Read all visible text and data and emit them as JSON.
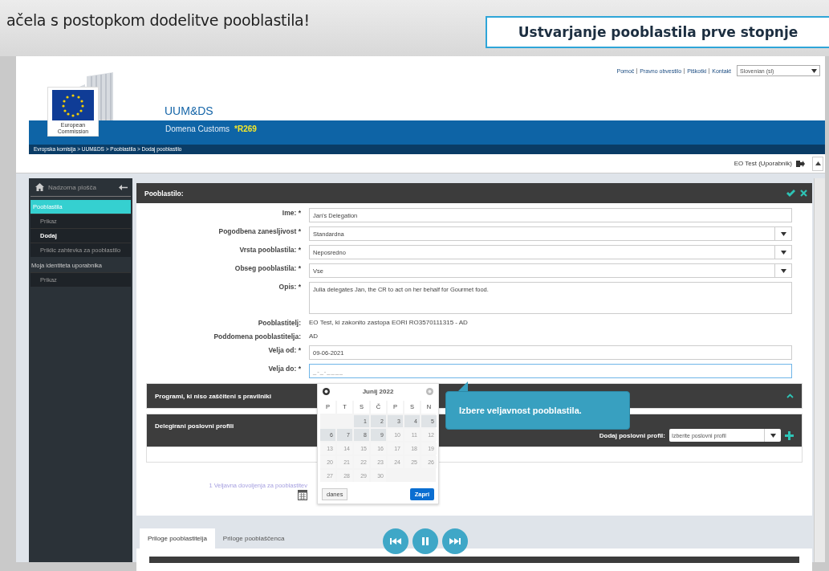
{
  "banner": {
    "caption": "ačela s postopkom dodelitve pooblastila!",
    "title": "Ustvarjanje pooblastila prve stopnje"
  },
  "top_links": [
    "Pomoč",
    "Pravno obvestilo",
    "Piškotki",
    "Kontakt"
  ],
  "language_select": {
    "value": "Slovenian (sl)"
  },
  "logo": {
    "caption": "European Commission"
  },
  "site": {
    "title": "UUM&DS",
    "domain": "Domena Customs",
    "code": "*R269"
  },
  "breadcrumb": "Evropska komisija > UUM&DS > Pooblastila > Dodaj pooblastilo",
  "user": {
    "name": "EO Test (Uporabnik)"
  },
  "sidebar": {
    "header": "Nadzorna plošča",
    "items": [
      {
        "label": "Pooblastila",
        "selected": true,
        "children": [
          {
            "label": "Prikaz",
            "selected": false
          },
          {
            "label": "Dodaj",
            "selected": true
          },
          {
            "label": "Priklic zahtevka za pooblastilo",
            "selected": false
          }
        ]
      },
      {
        "label": "Moja identiteta uporabnika",
        "selected": false,
        "children": [
          {
            "label": "Prikaz",
            "selected": false
          }
        ]
      }
    ]
  },
  "panel": {
    "title": "Pooblastilo:"
  },
  "fields": [
    {
      "kind": "text",
      "label": "Ime: *",
      "value": "Jan's Delegation"
    },
    {
      "kind": "select",
      "label": "Pogodbena zanesljivost *",
      "value": "Standardna"
    },
    {
      "kind": "select",
      "label": "Vrsta pooblastila: *",
      "value": "Neposredno"
    },
    {
      "kind": "select",
      "label": "Obseg pooblastila: *",
      "value": "Vse"
    },
    {
      "kind": "textarea",
      "label": "Opis: *",
      "value": "Julia delegates Jan, the CR to act on her behalf for Gourmet food."
    },
    {
      "kind": "static",
      "label": "Pooblastitelj:",
      "value": "EO Test, ki zakonito zastopa EORI RO3570111315 - AD"
    },
    {
      "kind": "static",
      "label": "Poddomena pooblastitelja:",
      "value": "AD"
    },
    {
      "kind": "text",
      "label": "Velja od: *",
      "value": "09-06-2021"
    },
    {
      "kind": "date",
      "label": "Velja do: *",
      "placeholder": "_-_-____"
    }
  ],
  "sections": [
    {
      "kind": "collapsible",
      "title": "Programi, ki niso zaščiteni s pravilniki"
    },
    {
      "kind": "profiles",
      "title": "Delegirani poslovni profili",
      "add_label": "Dodaj poslovni profil:",
      "select_placeholder": "Izberite poslovni profil"
    }
  ],
  "permissions_link": "1 Veljavna dovoljenja za pooblastitev",
  "datepicker": {
    "month": "Junij 2022",
    "weekdays": [
      "P",
      "T",
      "S",
      "Č",
      "P",
      "S",
      "N"
    ],
    "days": [
      {
        "label": "1",
        "disabled": false
      },
      {
        "label": "2",
        "disabled": false
      },
      {
        "label": "3",
        "disabled": false
      },
      {
        "label": "4",
        "disabled": false
      },
      {
        "label": "5",
        "disabled": false
      },
      {
        "label": "6",
        "disabled": false
      },
      {
        "label": "7",
        "disabled": false
      },
      {
        "label": "8",
        "disabled": false
      },
      {
        "label": "9",
        "disabled": false
      },
      {
        "label": "10",
        "disabled": true
      },
      {
        "label": "11",
        "disabled": true
      },
      {
        "label": "12",
        "disabled": true
      },
      {
        "label": "13",
        "disabled": true
      },
      {
        "label": "14",
        "disabled": true
      },
      {
        "label": "15",
        "disabled": true
      },
      {
        "label": "16",
        "disabled": true
      },
      {
        "label": "17",
        "disabled": true
      },
      {
        "label": "18",
        "disabled": true
      },
      {
        "label": "19",
        "disabled": true
      },
      {
        "label": "20",
        "disabled": true
      },
      {
        "label": "21",
        "disabled": true
      },
      {
        "label": "22",
        "disabled": true
      },
      {
        "label": "23",
        "disabled": true
      },
      {
        "label": "24",
        "disabled": true
      },
      {
        "label": "25",
        "disabled": true
      },
      {
        "label": "26",
        "disabled": true
      },
      {
        "label": "27",
        "disabled": true
      },
      {
        "label": "28",
        "disabled": true
      },
      {
        "label": "29",
        "disabled": true
      },
      {
        "label": "30",
        "disabled": true
      }
    ],
    "today_button": "danes",
    "close_button": "Zapri"
  },
  "tooltip": "Izbere veljavnost pooblastila.",
  "tabs": [
    {
      "label": "Priloge pooblastitelja",
      "selected": true
    },
    {
      "label": "Priloge pooblaščenca",
      "selected": false
    }
  ]
}
